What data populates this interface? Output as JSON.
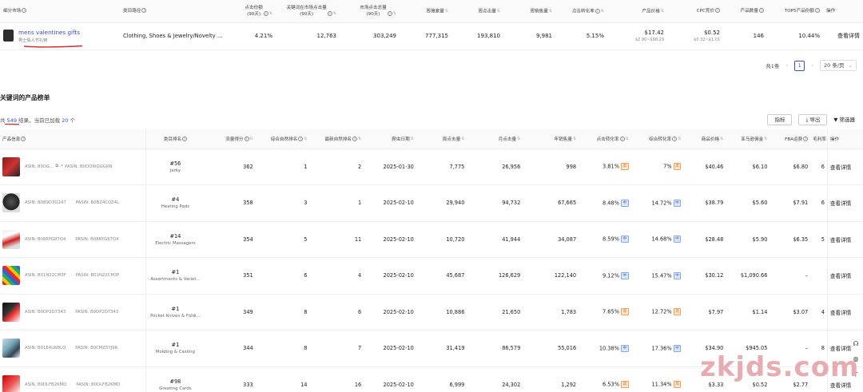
{
  "top_table": {
    "headers": [
      "细分市场",
      "类目路径",
      "点击份额\n(90天)",
      "关键词在市场点击量\n(90天)",
      "市场点击总量\n(90天)",
      "周搜索量",
      "周点击量",
      "周销售量",
      "点击转化率",
      "产品价格",
      "CPC竞价",
      "产品数量",
      "TOP5产品份额",
      "操作"
    ],
    "row": {
      "keyword": "mens valentines gifts",
      "keyword_cn": "男士情人节礼物",
      "category": "Clothing, Shoes & Jewelry/Novelty & ...",
      "click_share": "4.21%",
      "kw_clicks": "12,763",
      "market_clicks": "303,249",
      "weekly_search": "777,315",
      "weekly_clicks": "193,810",
      "weekly_sales": "9,981",
      "cvr": "5.15%",
      "price": "$17.42",
      "price_range": "$2.90~$98.29",
      "cpc": "$0.52",
      "cpc_range": "$0.32~$1.01",
      "product_count": "146",
      "top5_share": "10.44%",
      "action": "查看详情"
    }
  },
  "pager": {
    "total": "共1条",
    "prev": "‹",
    "page": "1",
    "next": "›",
    "size": "20 条/页"
  },
  "section_title": "关键词的产品榜单",
  "summary": {
    "pre": "共",
    "count": "549",
    "mid": "结果，当前已加载",
    "loaded": "20",
    "post": "个"
  },
  "tools": {
    "metrics": "指标",
    "export": "导出",
    "filter": "筛选器"
  },
  "product_headers": [
    "产品信息",
    "类目排名",
    "流量得分",
    "综合自然排名",
    "最新自然排名",
    "爬虫日期",
    "周点击量",
    "月点击量",
    "年销售量",
    "点击转化率",
    "综合转化率",
    "商品价格",
    "亚马逊佣金",
    "FBA运费",
    "毛利率",
    "操作"
  ],
  "products": [
    {
      "asin": "ASIN: B0DG...",
      "pasin": "PASIN: B0DQWQGGRN",
      "rank": "#56",
      "category": "Jerky",
      "score": "362",
      "overall": "1",
      "latest": "2",
      "date": "2025-01-30",
      "wclicks": "7,775",
      "mclicks": "26,956",
      "ysales": "998",
      "cvr": "3.81%",
      "cvr_tag": "高",
      "ccvr": "7%",
      "ccvr_tag": "高",
      "price": "$40.46",
      "comm": "$6.10",
      "fba": "$6.80",
      "margin": "6",
      "action": "查看详情"
    },
    {
      "asin": "ASIN: B0B9D3Q247",
      "pasin": "PASIN: B0BZ4CQZ4L",
      "rank": "#4",
      "category": "Heating Pads",
      "score": "358",
      "overall": "3",
      "latest": "1",
      "date": "2025-02-10",
      "wclicks": "29,940",
      "mclicks": "94,732",
      "ysales": "67,665",
      "cvr": "8.48%",
      "cvr_tag": "中",
      "ccvr": "14.72%",
      "ccvr_tag": "中",
      "price": "$38.79",
      "comm": "$5.60",
      "fba": "$7.91",
      "margin": "6",
      "action": "查看详情"
    },
    {
      "asin": "ASIN: B08RYG87Q4",
      "pasin": "PASIN: B08RYG87Q4",
      "rank": "#14",
      "category": "Electric Massagers",
      "score": "354",
      "overall": "5",
      "latest": "11",
      "date": "2025-02-10",
      "wclicks": "10,720",
      "mclicks": "41,944",
      "ysales": "34,087",
      "cvr": "8.59%",
      "cvr_tag": "中",
      "ccvr": "14.68%",
      "ccvr_tag": "中",
      "price": "$28.48",
      "comm": "$5.90",
      "fba": "$6.35",
      "margin": "5",
      "action": "查看详情"
    },
    {
      "asin": "ASIN: B01N22CM3F",
      "pasin": "PASIN: B01N22CM3F",
      "rank": "#1",
      "category": "Assortments & Variet...",
      "score": "351",
      "overall": "6",
      "latest": "4",
      "date": "2025-02-10",
      "wclicks": "45,687",
      "mclicks": "126,629",
      "ysales": "122,140",
      "cvr": "9.12%",
      "cvr_tag": "中",
      "ccvr": "15.47%",
      "ccvr_tag": "中",
      "price": "$30.12",
      "comm": "$1,090.66",
      "fba": "–",
      "margin": "",
      "action": "查看详情"
    },
    {
      "asin": "ASIN: B0DP2D7343",
      "pasin": "PASIN: B0DP2D7343",
      "rank": "#1",
      "category": "Pocket Knives & Foldi...",
      "score": "349",
      "overall": "8",
      "latest": "6",
      "date": "2025-02-10",
      "wclicks": "10,886",
      "mclicks": "21,650",
      "ysales": "1,783",
      "cvr": "7.65%",
      "cvr_tag": "高",
      "ccvr": "12.72%",
      "ccvr_tag": "高",
      "price": "$7.97",
      "comm": "$1.14",
      "fba": "$3.07",
      "margin": "4",
      "action": "查看详情"
    },
    {
      "asin": "ASIN: B01E4LW8LQ",
      "pasin": "PASIN: B0CMZ5YJ9R",
      "rank": "#1",
      "category": "Molding & Casting",
      "score": "344",
      "overall": "8",
      "latest": "7",
      "date": "2025-02-10",
      "wclicks": "31,419",
      "mclicks": "86,579",
      "ysales": "55,016",
      "cvr": "10.38%",
      "cvr_tag": "中",
      "ccvr": "17.36%",
      "ccvr_tag": "中",
      "price": "$34.90",
      "comm": "$945.05",
      "fba": "–",
      "margin": "8",
      "action": "查看详情"
    },
    {
      "asin": "ASIN: B0DLFB2KMD",
      "pasin": "PASIN: B0DLFB2KMD",
      "rank": "#98",
      "category": "Greeting Cards",
      "score": "333",
      "overall": "14",
      "latest": "16",
      "date": "2025-02-10",
      "wclicks": "6,999",
      "mclicks": "24,302",
      "ysales": "1,292",
      "cvr": "6.53%",
      "cvr_tag": "高",
      "ccvr": "11.34%",
      "ccvr_tag": "高",
      "price": "$3.33",
      "comm": "$0.52",
      "fba": "$2.77",
      "margin": "",
      "action": "查看详情"
    }
  ],
  "watermark": "zkjds.com",
  "colors": {
    "link": "#3b4bd8",
    "tag_high": "#e07a20",
    "tag_mid": "#3a66d0",
    "annotation": "#d92b2b"
  },
  "float_icons": [
    "headset-icon",
    "globe-icon",
    "back-to-top-icon"
  ]
}
